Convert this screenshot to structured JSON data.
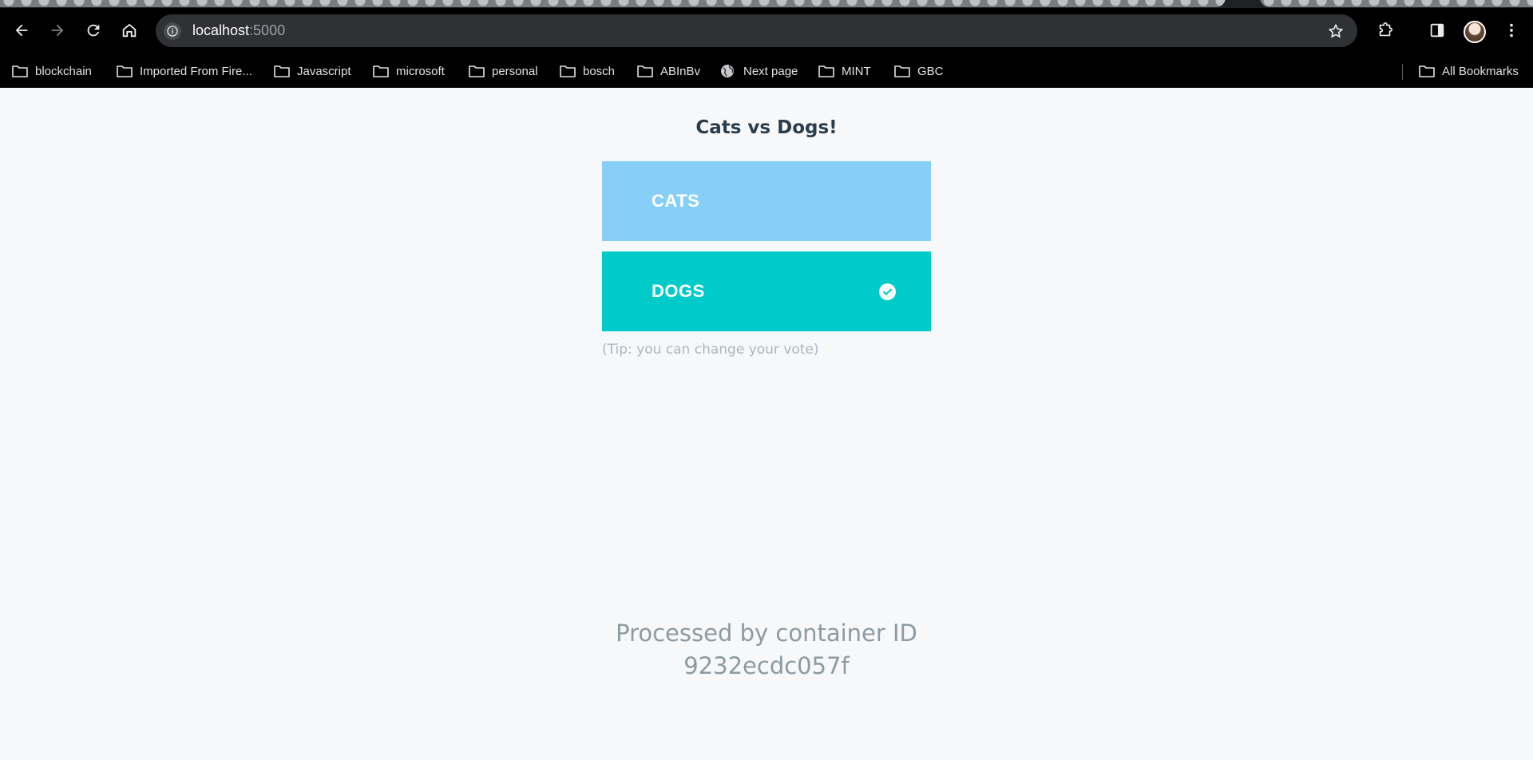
{
  "browser": {
    "url_host": "localhost",
    "url_port": ":5000",
    "bookmarks": [
      {
        "label": "blockchain",
        "icon": "folder-icon"
      },
      {
        "label": "Imported From Fire...",
        "icon": "folder-icon"
      },
      {
        "label": "Javascript",
        "icon": "folder-icon"
      },
      {
        "label": "microsoft",
        "icon": "folder-icon"
      },
      {
        "label": "personal",
        "icon": "folder-icon"
      },
      {
        "label": "bosch",
        "icon": "folder-icon"
      },
      {
        "label": "ABInBv",
        "icon": "folder-icon"
      },
      {
        "label": "Next page",
        "icon": "globe-icon"
      },
      {
        "label": "MINT",
        "icon": "folder-icon"
      },
      {
        "label": "GBC",
        "icon": "folder-icon"
      }
    ],
    "all_bookmarks_label": "All Bookmarks"
  },
  "page": {
    "title": "Cats vs Dogs!",
    "options": [
      {
        "label": "CATS",
        "selected": false,
        "color": "#87cff8"
      },
      {
        "label": "DOGS",
        "selected": true,
        "color": "#00cbca"
      }
    ],
    "tip": "(Tip: you can change your vote)",
    "footer_line1": "Processed by container ID",
    "footer_line2": "9232ecdc057f"
  }
}
